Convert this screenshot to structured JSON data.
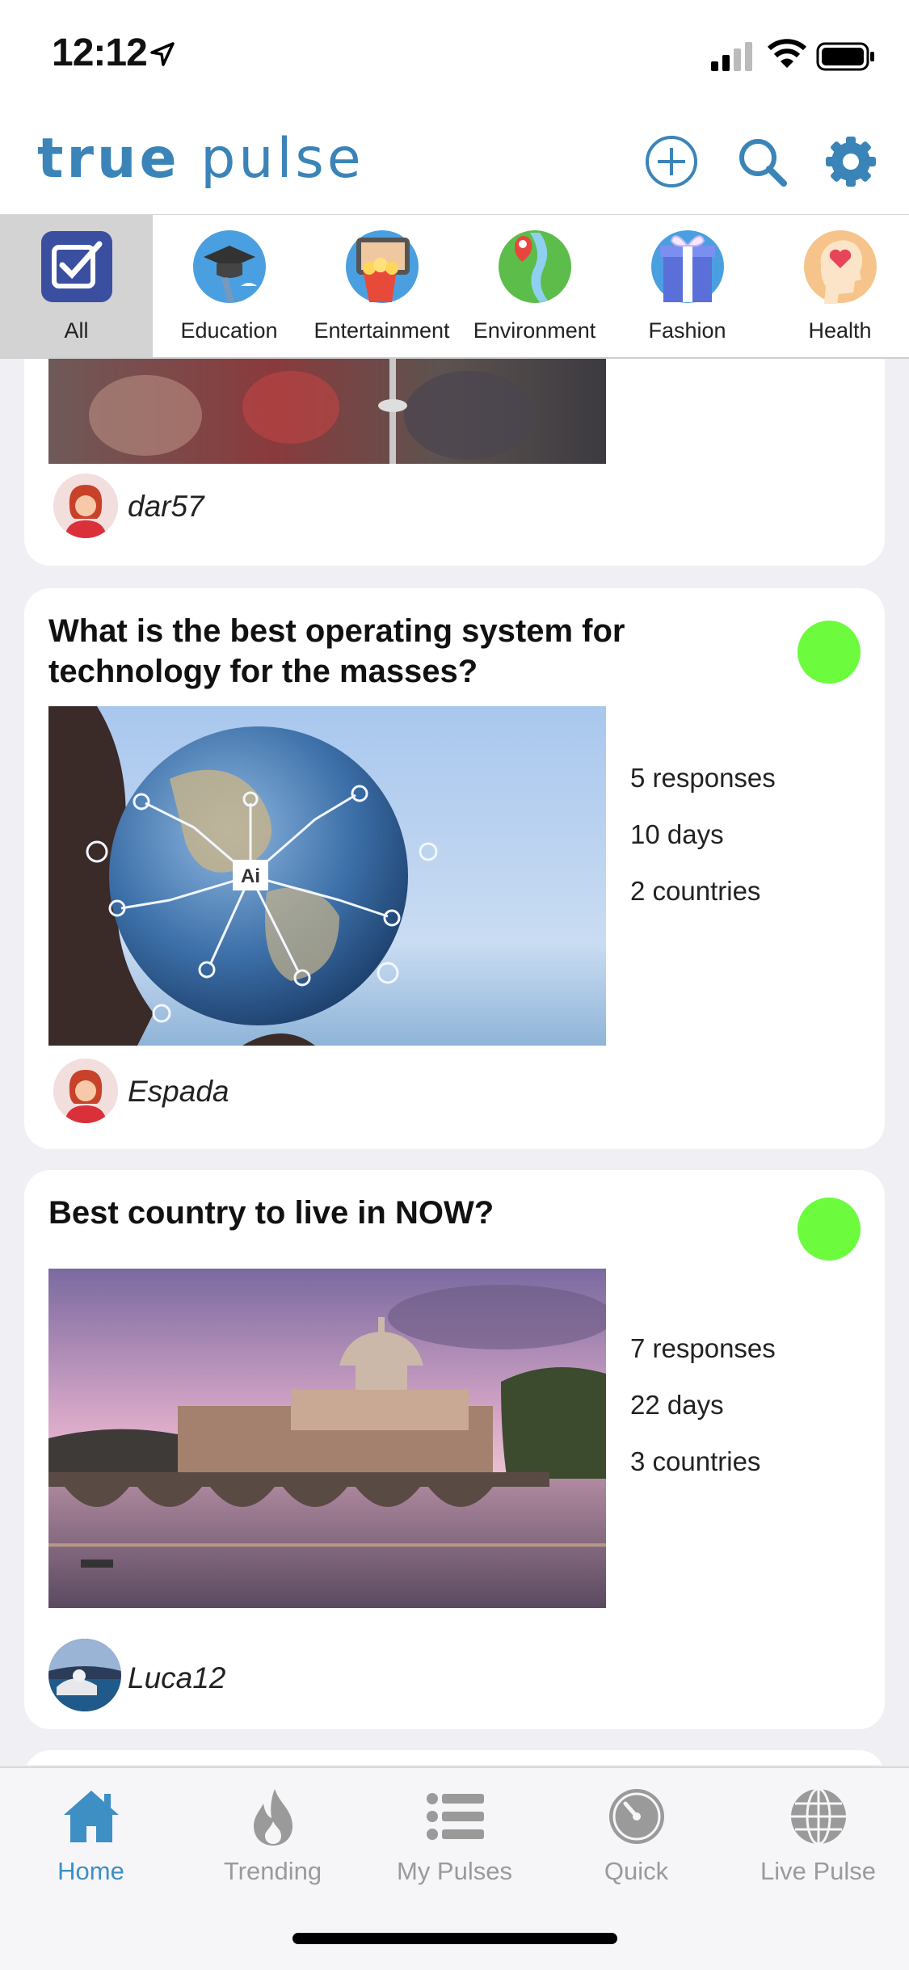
{
  "status_bar": {
    "time": "12:12"
  },
  "header": {
    "logo_bold": "true",
    "logo_light": " pulse"
  },
  "categories": [
    {
      "label": "All",
      "icon": "check-box-icon"
    },
    {
      "label": "Education",
      "icon": "graduation-icon"
    },
    {
      "label": "Entertainment",
      "icon": "popcorn-screen-icon"
    },
    {
      "label": "Environment",
      "icon": "earth-pin-icon"
    },
    {
      "label": "Fashion",
      "icon": "gift-icon"
    },
    {
      "label": "Health",
      "icon": "head-heart-icon"
    }
  ],
  "feed": {
    "card0": {
      "username": "dar57"
    },
    "card1": {
      "title": "What is the best operating system for technology for the masses?",
      "responses": "5 responses",
      "days": "10 days",
      "countries": "2 countries",
      "username": "Espada",
      "image_label": "Ai"
    },
    "card2": {
      "title": "Best country to live in NOW?",
      "responses": "7 responses",
      "days": "22 days",
      "countries": "3 countries",
      "username": "Luca12"
    }
  },
  "tabs": [
    {
      "label": "Home",
      "icon": "home-icon",
      "active": true
    },
    {
      "label": "Trending",
      "icon": "flame-icon",
      "active": false
    },
    {
      "label": "My Pulses",
      "icon": "list-icon",
      "active": false
    },
    {
      "label": "Quick",
      "icon": "timer-icon",
      "active": false
    },
    {
      "label": "Live Pulse",
      "icon": "globe-icon",
      "active": false
    }
  ],
  "colors": {
    "brand": "#3b84b8",
    "active_tab": "#3e8fc4",
    "status_dot": "#6dfb3e"
  }
}
